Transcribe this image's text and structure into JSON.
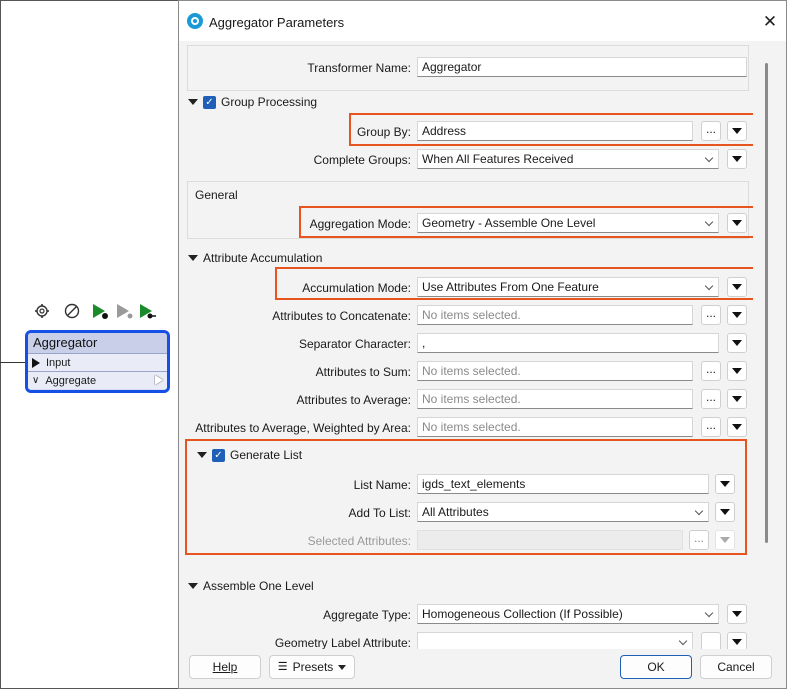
{
  "workspace": {
    "node": {
      "title": "Aggregator",
      "input_port": "Input",
      "output_port": "Aggregate"
    },
    "toolbar_icons": [
      "gear-icon",
      "disable-icon",
      "run-to-here-icon",
      "run-step-icon",
      "run-from-here-icon"
    ]
  },
  "dialog": {
    "title": "Aggregator Parameters",
    "transformer_name_label": "Transformer Name:",
    "transformer_name_value": "Aggregator",
    "group_processing": {
      "header": "Group Processing",
      "checked": true,
      "group_by_label": "Group By:",
      "group_by_value": "Address",
      "complete_groups_label": "Complete Groups:",
      "complete_groups_value": "When All Features Received"
    },
    "general": {
      "header": "General",
      "aggregation_mode_label": "Aggregation Mode:",
      "aggregation_mode_value": "Geometry - Assemble One Level"
    },
    "attribute_accumulation": {
      "header": "Attribute Accumulation",
      "accumulation_mode_label": "Accumulation Mode:",
      "accumulation_mode_value": "Use Attributes From One Feature",
      "concat_label": "Attributes to Concatenate:",
      "concat_placeholder": "No items selected.",
      "separator_label": "Separator Character:",
      "separator_value": ",",
      "sum_label": "Attributes to Sum:",
      "sum_placeholder": "No items selected.",
      "average_label": "Attributes to Average:",
      "average_placeholder": "No items selected.",
      "weighted_label": "Attributes to Average, Weighted by Area:",
      "weighted_placeholder": "No items selected."
    },
    "generate_list": {
      "header": "Generate List",
      "checked": true,
      "list_name_label": "List Name:",
      "list_name_value": "igds_text_elements",
      "add_to_list_label": "Add To List:",
      "add_to_list_value": "All Attributes",
      "selected_attributes_label": "Selected Attributes:"
    },
    "assemble_one_level": {
      "header": "Assemble One Level",
      "aggregate_type_label": "Aggregate Type:",
      "aggregate_type_value": "Homogeneous Collection (If Possible)",
      "geometry_label_label": "Geometry Label Attribute:"
    },
    "buttons": {
      "help": "Help",
      "presets": "Presets",
      "ok": "OK",
      "cancel": "Cancel"
    },
    "ellipsis": "...",
    "close_glyph": "✕",
    "highlight_color": "#e8541f",
    "node_color": "#1450e6"
  }
}
